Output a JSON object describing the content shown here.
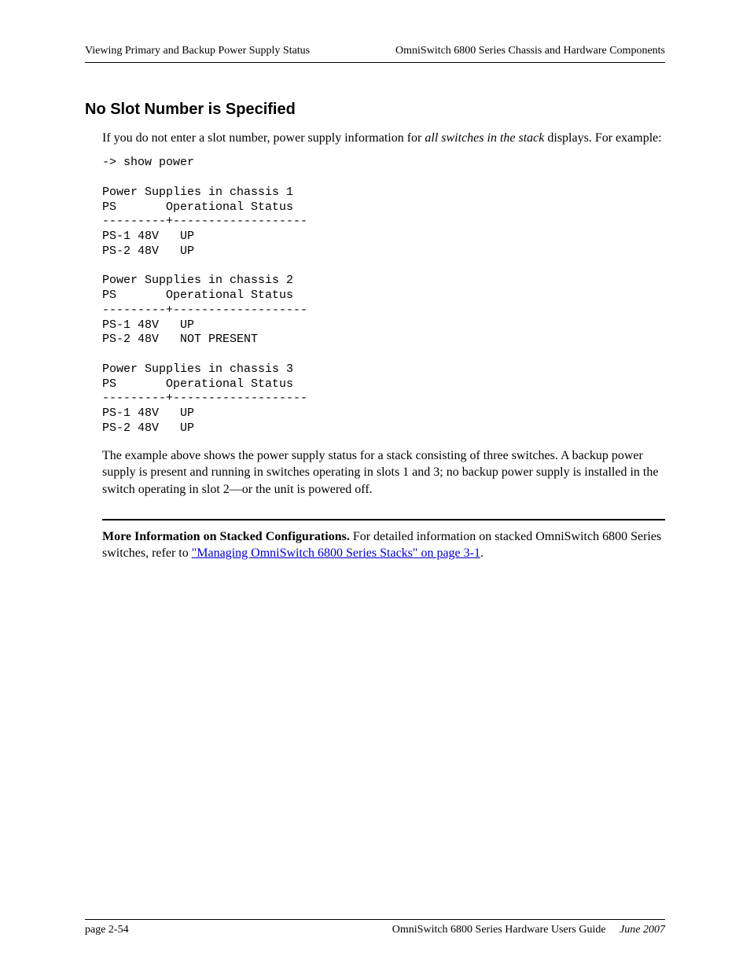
{
  "header": {
    "left": "Viewing Primary and Backup Power Supply Status",
    "right": "OmniSwitch 6800 Series Chassis and Hardware Components"
  },
  "section": {
    "heading": "No Slot Number is Specified",
    "intro_pre": "If you do not enter a slot number, power supply information for ",
    "intro_italic": "all switches in the stack",
    "intro_post": " displays. For example:",
    "code": "-> show power\n\nPower Supplies in chassis 1\nPS       Operational Status\n---------+-------------------\nPS-1 48V   UP\nPS-2 48V   UP\n\nPower Supplies in chassis 2\nPS       Operational Status\n---------+-------------------\nPS-1 48V   UP\nPS-2 48V   NOT PRESENT\n\nPower Supplies in chassis 3\nPS       Operational Status\n---------+-------------------\nPS-1 48V   UP\nPS-2 48V   UP",
    "after_code": "The example above shows the power supply status for a stack consisting of three switches. A backup power supply is present and running in switches operating in slots 1 and 3; no backup power supply is installed in the switch operating in slot 2—or the unit is powered off.",
    "more_info_bold": "More Information on Stacked Configurations.",
    "more_info_rest": " For detailed information on stacked OmniSwitch 6800 Series switches, refer to ",
    "more_info_link": "\"Managing OmniSwitch 6800 Series Stacks\" on page 3-1",
    "more_info_tail": "."
  },
  "footer": {
    "left": "page 2-54",
    "center": "OmniSwitch 6800 Series Hardware Users Guide",
    "date": "June 2007"
  }
}
